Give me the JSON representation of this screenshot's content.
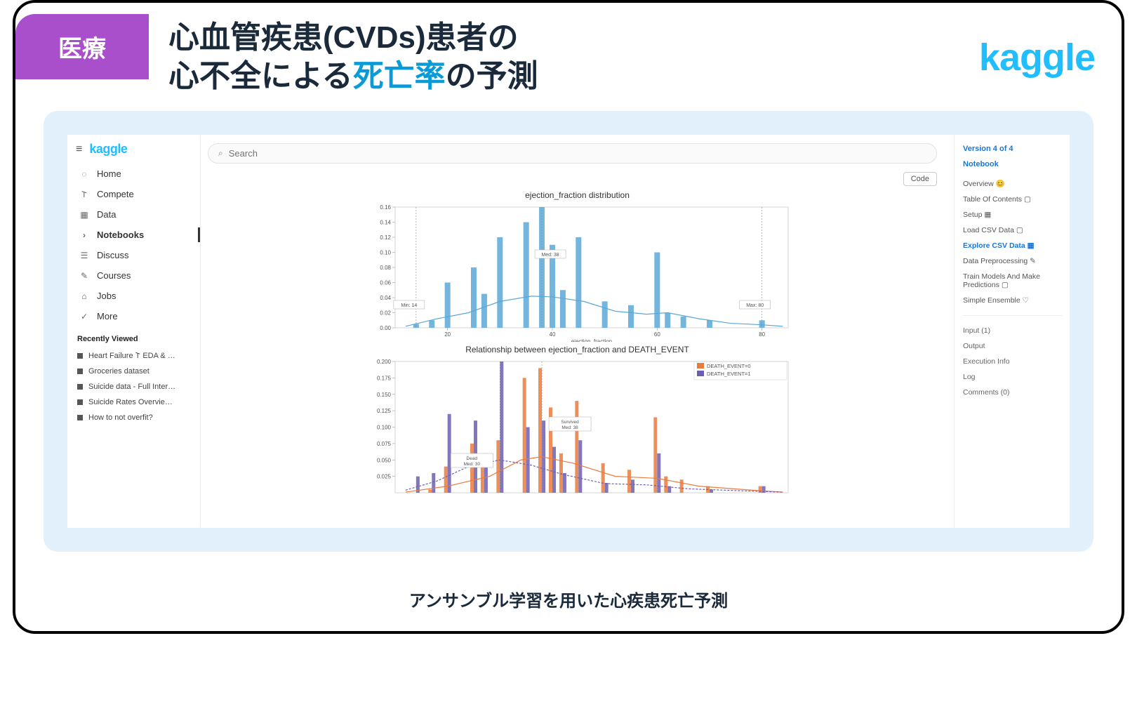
{
  "badge": "医療",
  "title_line1": "心血管疾患(CVDs)患者の",
  "title_line2_a": "心不全による",
  "title_line2_hl": "死亡率",
  "title_line2_b": "の予測",
  "brand": "kaggle",
  "caption": "アンサンブル学習を用いた心疾患死亡予測",
  "screenshot": {
    "sidebar_logo": "kaggle",
    "nav": [
      {
        "icon": "◌",
        "label": "Home"
      },
      {
        "icon": "𐌕",
        "label": "Compete"
      },
      {
        "icon": "▦",
        "label": "Data"
      },
      {
        "icon": "›",
        "label": "Notebooks",
        "active": true
      },
      {
        "icon": "☰",
        "label": "Discuss"
      },
      {
        "icon": "✎",
        "label": "Courses"
      },
      {
        "icon": "⌂",
        "label": "Jobs"
      },
      {
        "icon": "✓",
        "label": "More"
      }
    ],
    "recently_viewed_header": "Recently Viewed",
    "recently_viewed": [
      "Heart Failure 𐌕 EDA & …",
      "Groceries dataset",
      "Suicide data - Full Inter…",
      "Suicide Rates Overvie…",
      "How to not overfit?"
    ],
    "search_placeholder": "Search",
    "code_button": "Code",
    "rail": {
      "version": "Version 4 of 4",
      "notebook": "Notebook",
      "items": [
        {
          "label": "Overview 😊"
        },
        {
          "label": "Table Of Contents ▢"
        },
        {
          "label": "Setup ▦"
        },
        {
          "label": "Load CSV Data ▢"
        },
        {
          "label": "Explore CSV Data ▦",
          "selected": true
        },
        {
          "label": "Data Preprocessing ✎"
        },
        {
          "label": "Train Models And Make Predictions ▢"
        },
        {
          "label": "Simple Ensemble ♡"
        }
      ],
      "sections": [
        "Input (1)",
        "Output",
        "Execution Info",
        "Log",
        "Comments (0)"
      ]
    }
  },
  "chart_data": [
    {
      "type": "bar",
      "title": "ejection_fraction distribution",
      "xlabel": "ejection_fraction",
      "ylabel": "",
      "ylim": [
        0,
        0.16
      ],
      "yticks": [
        0,
        0.02,
        0.04,
        0.06,
        0.08,
        0.1,
        0.12,
        0.14,
        0.16
      ],
      "xlim": [
        10,
        85
      ],
      "xticks": [
        20,
        40,
        60,
        80
      ],
      "annotations": [
        {
          "label": "Min: 14",
          "x": 14
        },
        {
          "label": "Med: 38",
          "x": 38
        },
        {
          "label": "Max: 80",
          "x": 80
        }
      ],
      "bars_x": [
        14,
        17,
        20,
        25,
        27,
        30,
        35,
        38,
        40,
        42,
        45,
        50,
        55,
        60,
        62,
        65,
        70,
        80
      ],
      "values": [
        0.005,
        0.01,
        0.06,
        0.08,
        0.045,
        0.12,
        0.14,
        0.16,
        0.11,
        0.05,
        0.12,
        0.035,
        0.03,
        0.1,
        0.02,
        0.015,
        0.01,
        0.01
      ],
      "kde": [
        {
          "x": 12,
          "y": 0.002
        },
        {
          "x": 18,
          "y": 0.012
        },
        {
          "x": 24,
          "y": 0.02
        },
        {
          "x": 30,
          "y": 0.035
        },
        {
          "x": 36,
          "y": 0.042
        },
        {
          "x": 40,
          "y": 0.041
        },
        {
          "x": 46,
          "y": 0.035
        },
        {
          "x": 52,
          "y": 0.022
        },
        {
          "x": 58,
          "y": 0.018
        },
        {
          "x": 62,
          "y": 0.02
        },
        {
          "x": 68,
          "y": 0.012
        },
        {
          "x": 74,
          "y": 0.006
        },
        {
          "x": 80,
          "y": 0.004
        },
        {
          "x": 84,
          "y": 0.002
        }
      ]
    },
    {
      "type": "bar",
      "title": "Relationship between ejection_fraction and DEATH_EVENT",
      "xlabel": "",
      "ylabel": "",
      "ylim": [
        0,
        0.2
      ],
      "yticks": [
        0.025,
        0.05,
        0.075,
        0.1,
        0.125,
        0.15,
        0.175,
        0.2
      ],
      "xlim": [
        10,
        85
      ],
      "legend": [
        "DEATH_EVENT=0",
        "DEATH_EVENT=1"
      ],
      "legend_colors": [
        "#E97B3D",
        "#6B5FB3"
      ],
      "annotations": [
        {
          "label": "Dead Med: 30",
          "x": 30
        },
        {
          "label": "Survived Med: 38",
          "x": 38
        }
      ],
      "bars_x": [
        14,
        17,
        20,
        25,
        27,
        30,
        35,
        38,
        40,
        42,
        45,
        50,
        55,
        60,
        62,
        65,
        70,
        80
      ],
      "series": [
        {
          "name": "DEATH_EVENT=0",
          "color": "#E97B3D",
          "values": [
            0.0,
            0.005,
            0.04,
            0.075,
            0.04,
            0.08,
            0.175,
            0.19,
            0.13,
            0.06,
            0.14,
            0.045,
            0.035,
            0.115,
            0.025,
            0.02,
            0.01,
            0.01
          ]
        },
        {
          "name": "DEATH_EVENT=1",
          "color": "#6B5FB3",
          "values": [
            0.025,
            0.03,
            0.12,
            0.11,
            0.06,
            0.2,
            0.1,
            0.11,
            0.07,
            0.03,
            0.08,
            0.015,
            0.02,
            0.06,
            0.01,
            0.0,
            0.005,
            0.01
          ]
        }
      ],
      "kde": [
        {
          "name": "DEATH_EVENT=0",
          "color": "#E97B3D",
          "points": [
            {
              "x": 12,
              "y": 0.001
            },
            {
              "x": 20,
              "y": 0.01
            },
            {
              "x": 28,
              "y": 0.025
            },
            {
              "x": 34,
              "y": 0.05
            },
            {
              "x": 38,
              "y": 0.055
            },
            {
              "x": 44,
              "y": 0.045
            },
            {
              "x": 52,
              "y": 0.025
            },
            {
              "x": 60,
              "y": 0.022
            },
            {
              "x": 68,
              "y": 0.01
            },
            {
              "x": 78,
              "y": 0.004
            },
            {
              "x": 84,
              "y": 0.001
            }
          ]
        },
        {
          "name": "DEATH_EVENT=1",
          "color": "#6B5FB3",
          "points": [
            {
              "x": 12,
              "y": 0.004
            },
            {
              "x": 18,
              "y": 0.018
            },
            {
              "x": 24,
              "y": 0.04
            },
            {
              "x": 30,
              "y": 0.05
            },
            {
              "x": 36,
              "y": 0.042
            },
            {
              "x": 42,
              "y": 0.028
            },
            {
              "x": 50,
              "y": 0.014
            },
            {
              "x": 58,
              "y": 0.012
            },
            {
              "x": 66,
              "y": 0.006
            },
            {
              "x": 76,
              "y": 0.003
            },
            {
              "x": 84,
              "y": 0.001
            }
          ]
        }
      ]
    }
  ]
}
